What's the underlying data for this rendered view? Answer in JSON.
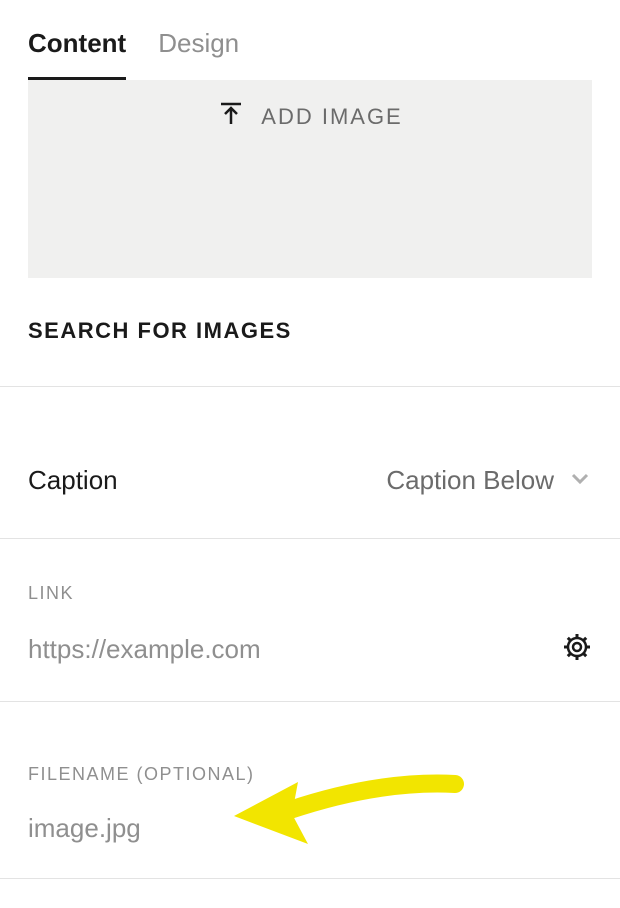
{
  "tabs": {
    "content": "Content",
    "design": "Design"
  },
  "upload": {
    "label": "ADD IMAGE"
  },
  "search": {
    "label": "SEARCH FOR IMAGES"
  },
  "caption": {
    "label": "Caption",
    "selected": "Caption Below"
  },
  "link": {
    "label": "LINK",
    "placeholder": "https://example.com",
    "value": ""
  },
  "filename": {
    "label": "FILENAME (OPTIONAL)",
    "placeholder": "image.jpg",
    "value": ""
  }
}
